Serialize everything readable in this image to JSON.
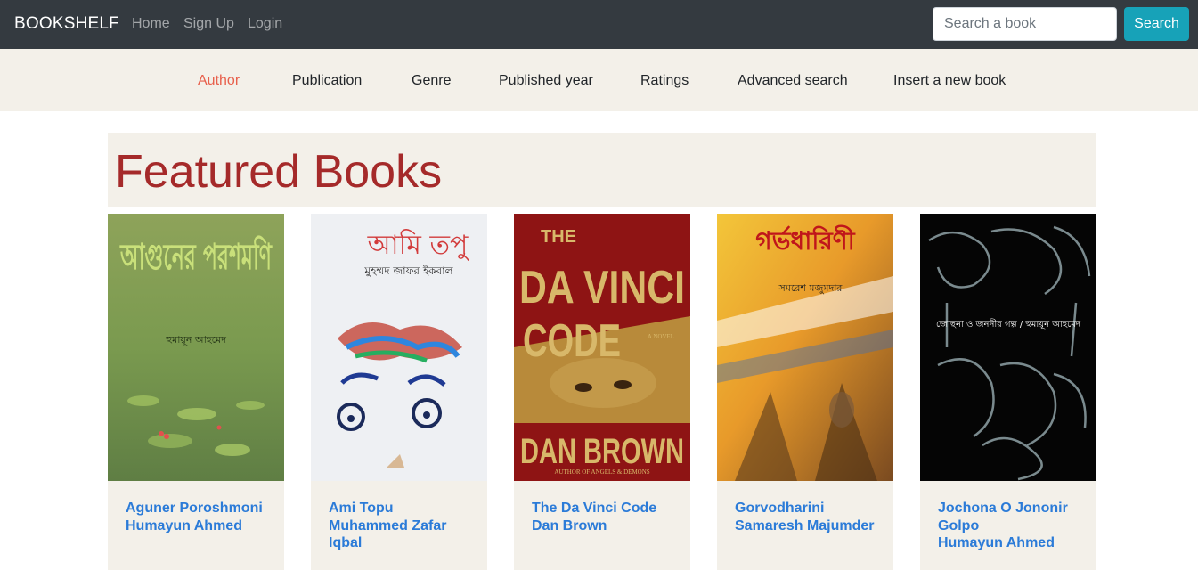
{
  "navbar": {
    "brand": "BOOKSHELF",
    "links": [
      "Home",
      "Sign Up",
      "Login"
    ],
    "search_placeholder": "Search a book",
    "search_button": "Search"
  },
  "subnav": {
    "items": [
      "Author",
      "Publication",
      "Genre",
      "Published year",
      "Ratings",
      "Advanced search",
      "Insert a new book"
    ],
    "active": "Author"
  },
  "hero": {
    "title": "Featured Books"
  },
  "books": [
    {
      "title": "Aguner Poroshmoni",
      "author": "Humayun Ahmed",
      "cover_title": "আগুনের পরশমণি",
      "cover_author": "হুমায়ূন আহমেদ"
    },
    {
      "title": "Ami Topu",
      "author": "Muhammed Zafar Iqbal",
      "cover_title": "আমি তপু",
      "cover_author": "মুহম্মদ জাফর ইকবাল"
    },
    {
      "title": "The Da Vinci Code",
      "author": "Dan Brown",
      "cover_title_1": "THE",
      "cover_title_2": "DA VINCI",
      "cover_title_3": "CODE",
      "cover_tag": "A NOVEL",
      "cover_author": "DAN BROWN",
      "cover_sub": "AUTHOR OF ANGELS & DEMONS"
    },
    {
      "title": "Gorvodharini",
      "author": "Samaresh Majumder",
      "cover_title": "গর্ভধারিণী",
      "cover_author": "সমরেশ মজুমদার"
    },
    {
      "title": "Jochona O Jononir Golpo",
      "author": "Humayun Ahmed",
      "cover_title": "জোছনা ও জননীর গল্প / হুমায়ূন আহমেদ"
    }
  ],
  "colors": {
    "navbar": "#343a40",
    "accent_active": "#e8604c",
    "hero_title": "#a52a2a",
    "link": "#2b7bd8",
    "search_button": "#17a2b8",
    "panel": "#f3f0e9"
  }
}
